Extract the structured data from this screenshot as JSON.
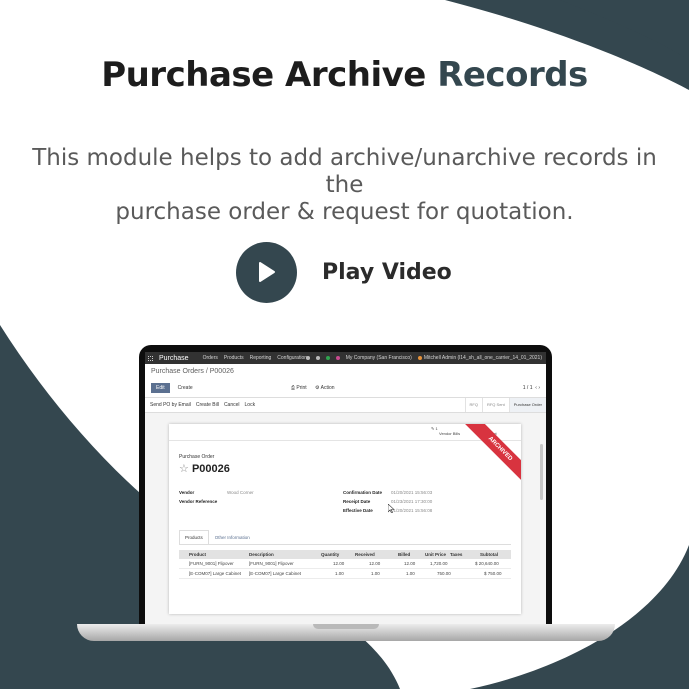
{
  "banner": {
    "title_main": "Purchase Archive",
    "title_accent": "Records",
    "subtitle_line1": "This module helps to add archive/unarchive records in the",
    "subtitle_line2": "purchase order & request for quotation.",
    "play_label": "Play Video",
    "colors": {
      "dark": "#34474f",
      "title": "#1d1d1d",
      "subtitle": "#5a5a5a"
    }
  },
  "odoo": {
    "topbar": {
      "app": "Purchase",
      "menus": [
        "Orders",
        "Products",
        "Reporting",
        "Configuration"
      ],
      "company": "My Company (San Francisco)",
      "user": "Mitchell Admin (l14_sh_all_one_carrier_14_01_2021)"
    },
    "breadcrumb": "Purchase Orders / P00026",
    "buttons": {
      "edit": "Edit",
      "create": "Create",
      "print": "Print",
      "action": "Action"
    },
    "pager": "1 / 1",
    "status_buttons": [
      "Send PO by Email",
      "Create Bill",
      "Cancel",
      "Lock"
    ],
    "stages": [
      "RFQ",
      "RFQ Sent",
      "Purchase Order"
    ],
    "smart_buttons": {
      "vendor_bills_count": "1",
      "vendor_bills_label": "Vendor Bills",
      "receipt_count": "1",
      "receipt_label": "Receipt"
    },
    "ribbon": "ARCHIVED",
    "doc_type": "Purchase Order",
    "doc_number": "P00026",
    "fields": {
      "vendor_label": "Vendor",
      "vendor_value": "Wood Corner",
      "vendor_ref_label": "Vendor Reference",
      "confirmation_label": "Confirmation Date",
      "confirmation_value": "01/20/2021 15:56:03",
      "receipt_label": "Receipt Date",
      "receipt_value": "01/23/2021 17:30:00",
      "effective_label": "Effective Date",
      "effective_value": "01/20/2021 15:56:08"
    },
    "tabs": [
      "Products",
      "Other Information"
    ],
    "table": {
      "headers": [
        "Product",
        "Description",
        "Quantity",
        "Received",
        "Billed",
        "Unit Price",
        "Taxes",
        "Subtotal"
      ],
      "rows": [
        [
          "[FURN_9001] Flipover",
          "[FURN_9001] Flipover",
          "12.00",
          "12.00",
          "12.00",
          "1,720.00",
          "",
          "$ 20,640.00"
        ],
        [
          "[E-COM07] Large Cabinet",
          "[E-COM07] Large Cabinet",
          "1.00",
          "1.00",
          "1.00",
          "750.00",
          "",
          "$ 750.00"
        ]
      ]
    }
  }
}
